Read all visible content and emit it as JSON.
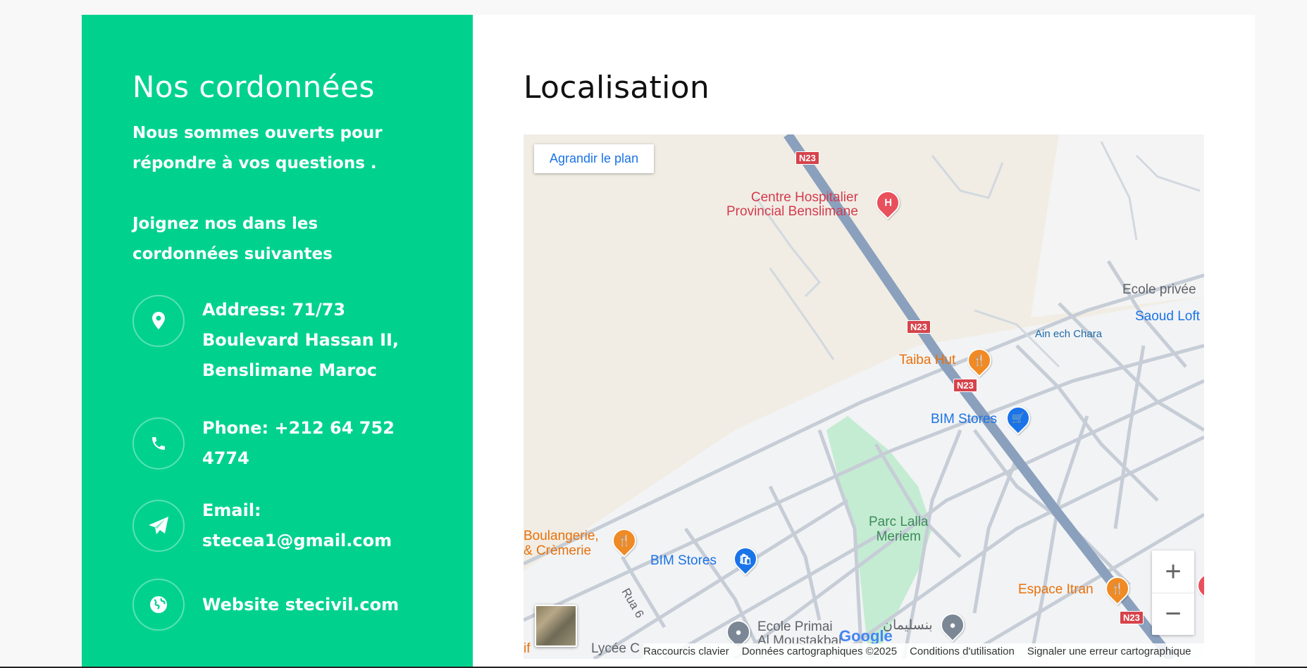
{
  "contact_panel": {
    "title": "Nos cordonnées",
    "intro_1": "Nous sommes ouverts pour répondre à vos questions .",
    "intro_2": "Joignez nos dans les cordonnées suivantes",
    "address": "Address: 71/73 Boulevard Hassan II, Benslimane Maroc",
    "phone_label": "Phone: ",
    "phone": "+212 64 752 4774",
    "email_label": "Email: ",
    "email": "stecea1@gmail.com",
    "website_label": "Website ",
    "website": "stecivil.com",
    "accent_color": "#00d28e",
    "icons": [
      "map-pin-icon",
      "phone-icon",
      "paper-plane-icon",
      "globe-icon"
    ]
  },
  "map_panel": {
    "title": "Localisation",
    "enlarge_label": "Agrandir le plan",
    "zoom_in": "+",
    "zoom_out": "−",
    "pois": {
      "hospital": "Centre Hospitalier\nProvincial Benslimane",
      "taiba": "Taiba Hut",
      "bim1": "BIM Stores",
      "bim2": "BIM Stores",
      "ecole_privee": "Ecole privée",
      "saoud": "Saoud Loft",
      "ain": "Ain ech Chara",
      "parc": "Parc Lalla\nMeriem",
      "boulangerie": "Boulangerie,\n& Crèmerie",
      "espace": "Espace Itran",
      "ecole_primaire": "Ecole Primai\nAl Moustakbal",
      "benslimane_ar": "بنسليمان",
      "rue": "Rua 6",
      "lycee": "Lycée C",
      "if": "if"
    },
    "road_shield": "N23",
    "google_logo": "Google",
    "footer": {
      "shortcuts": "Raccourcis clavier",
      "data": "Données cartographiques ©2025",
      "terms": "Conditions d'utilisation",
      "report": "Signaler une erreur cartographique"
    }
  }
}
